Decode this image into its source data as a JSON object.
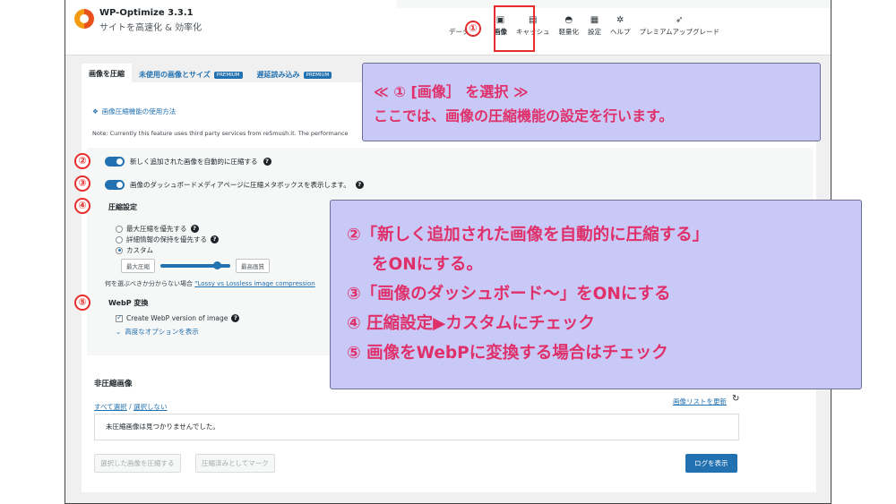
{
  "app": {
    "title": "WP-Optimize 3.3.1",
    "subtitle": "サイトを高速化 & 効率化"
  },
  "nav": [
    {
      "label": "データ",
      "icon": "database-icon"
    },
    {
      "label": "画像",
      "icon": "image-icon",
      "active": true
    },
    {
      "label": "キャッシュ",
      "icon": "cache-icon"
    },
    {
      "label": "軽量化",
      "icon": "minify-icon"
    },
    {
      "label": "設定",
      "icon": "settings-icon"
    },
    {
      "label": "ヘルプ",
      "icon": "help-icon"
    },
    {
      "label": "プレミアムアップグレード",
      "icon": "rocket-icon"
    }
  ],
  "tabs": [
    {
      "label": "画像を圧縮",
      "active": true
    },
    {
      "label": "未使用の画像とサイズ",
      "badge": "PREMIUM"
    },
    {
      "label": "遅延読み込み",
      "badge": "PREMIUM"
    }
  ],
  "howto": "画像圧縮機能の使用方法",
  "note": "Note: Currently this feature uses third party services from reSmush.it. The performance",
  "settings": {
    "auto_compress": "新しく追加された画像を自動的に圧縮する",
    "show_metabox": "画像のダッシュボードメディアページに圧縮メタボックスを表示します。",
    "compression_heading": "圧縮設定",
    "options": [
      "最大圧縮を優先する",
      "詳細情報の保持を優先する",
      "カスタム"
    ],
    "selected_option": "カスタム",
    "slider_min_label": "最大圧縮",
    "slider_max_label": "最高画質",
    "slider_value": 0.85,
    "lossy_prefix": "何を選ぶべきか分からない場合",
    "lossy_link": "\"Lossy vs Lossless image compression",
    "webp_heading": "WebP 変換",
    "webp_checkbox": "Create WebP version of image",
    "show_options": "高度なオプションを表示"
  },
  "uncompressed": {
    "heading": "非圧縮画像",
    "select_all": "すべて選択",
    "separator": "/",
    "select_none": "選択しない",
    "refresh": "画像リストを更新",
    "empty": "未圧縮画像は見つかりませんでした。",
    "btn_compress": "選択した画像を圧縮する",
    "btn_mark": "圧縮済みとしてマーク",
    "btn_log": "ログを表示"
  },
  "annotations": {
    "n1": "①",
    "n2": "②",
    "n3": "③",
    "n4": "④",
    "n5": "⑤",
    "callout1_line1": "≪ ① [画像］ を選択 ≫",
    "callout1_line2": "ここでは、画像の圧縮機能の設定を行います。",
    "callout2_line1": "②「新しく追加された画像を自動的に圧縮する」",
    "callout2_line2": "をONにする。",
    "callout2_line3": "③「画像のダッシュボード～」をONにする",
    "callout2_line4": "④ 圧縮設定▶カスタムにチェック",
    "callout2_line5": "⑤ 画像をWebPに変換する場合はチェック"
  },
  "colors": {
    "accent": "#2271b1",
    "annotation": "#e62c2c",
    "callout_bg": "#c9c9f7",
    "callout_text": "#e0306a"
  }
}
